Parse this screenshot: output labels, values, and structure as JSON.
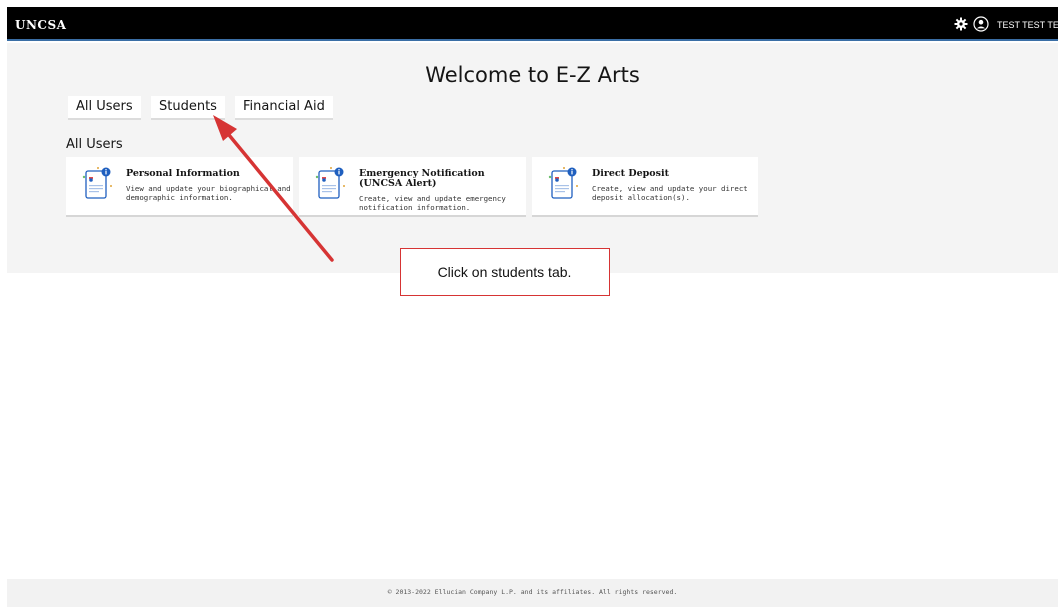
{
  "header": {
    "brand": "UNCSA",
    "user_name": "TEST TEST TEST",
    "settings_icon": "gear-icon",
    "user_icon": "user-icon"
  },
  "main": {
    "welcome": "Welcome to E-Z Arts",
    "tabs": [
      {
        "label": "All Users"
      },
      {
        "label": "Students"
      },
      {
        "label": "Financial Aid"
      }
    ],
    "section_title": "All Users",
    "cards": [
      {
        "title_lines": [
          "Personal Information"
        ],
        "desc_lines": [
          "View and update your biographical and",
          "demographic information."
        ],
        "icon": "document-icon"
      },
      {
        "title_lines": [
          "Emergency Notification",
          "(UNCSA Alert)"
        ],
        "desc_lines": [
          "Create, view and update emergency",
          "notification information."
        ],
        "icon": "document-icon"
      },
      {
        "title_lines": [
          "Direct Deposit"
        ],
        "desc_lines": [
          "Create, view and update your direct",
          "deposit allocation(s)."
        ],
        "icon": "document-icon"
      }
    ]
  },
  "annotation": {
    "callout_text": "Click on students tab.",
    "color": "#d63434"
  },
  "footer": {
    "text": "© 2013-2022 Ellucian Company L.P. and its affiliates. All rights reserved."
  },
  "colors": {
    "topbar": "#000000",
    "accent_line": "#3a6ea5",
    "icon_blue": "#1f5fbf"
  }
}
